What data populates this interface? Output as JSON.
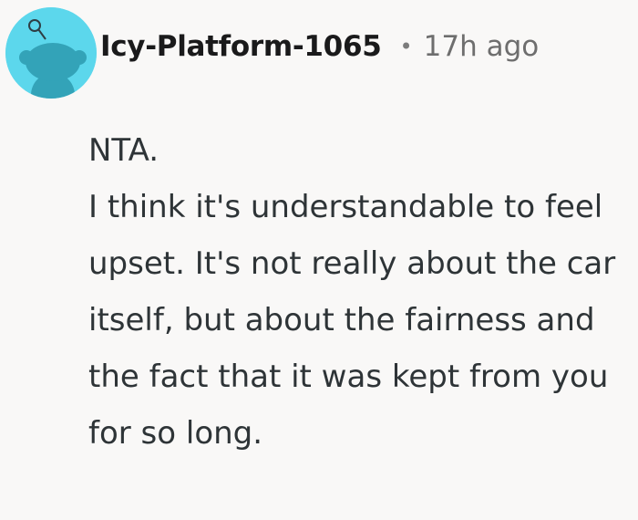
{
  "comment": {
    "author": "Icy-Platform-1065",
    "separator": "•",
    "timestamp": "17h ago",
    "body": [
      "NTA.",
      "I think it's understandable to feel upset. It's not really about the car itself, but about the fairness and the fact that it was kept from you for so long."
    ]
  },
  "avatar": {
    "icon": "snoo-icon",
    "background_color": "#5cd7ec"
  }
}
